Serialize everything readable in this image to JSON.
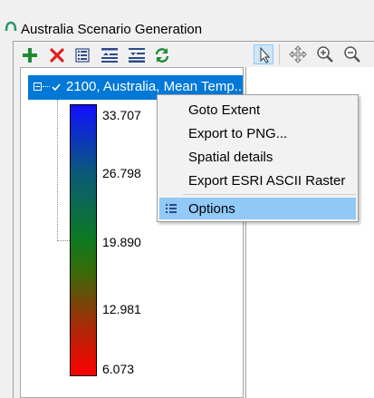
{
  "window": {
    "title": "Australia Scenario Generation",
    "app_icon": "app-icon"
  },
  "left_toolbar": {
    "buttons": [
      {
        "name": "add-layer-button",
        "icon": "plus-icon",
        "color": "#1e8a34"
      },
      {
        "name": "remove-layer-button",
        "icon": "red-x-icon",
        "color": "#e02020"
      },
      {
        "name": "properties-button",
        "icon": "list-icon",
        "color": "#2b4a8a"
      },
      {
        "name": "move-up-button",
        "icon": "move-up-icon",
        "color": "#2b4a8a"
      },
      {
        "name": "move-down-button",
        "icon": "move-down-icon",
        "color": "#2b4a8a"
      },
      {
        "name": "refresh-button",
        "icon": "refresh-icon",
        "color": "#1e8a34"
      }
    ]
  },
  "map_toolbar": {
    "buttons": [
      {
        "name": "select-tool-button",
        "icon": "pointer-icon",
        "active": true
      },
      {
        "name": "pan-tool-button",
        "icon": "pan-icon",
        "active": false
      },
      {
        "name": "zoom-in-button",
        "icon": "zoom-in-icon",
        "active": false
      },
      {
        "name": "zoom-out-button",
        "icon": "zoom-out-icon",
        "active": false
      }
    ]
  },
  "layer_tree": {
    "layer": {
      "label": "2100, Australia, Mean Temp...",
      "checked": true,
      "expanded": true
    },
    "legend": {
      "labels": [
        "33.707",
        "26.798",
        "19.890",
        "12.981",
        "6.073"
      ],
      "colors": [
        "#1010ff",
        "#0d7a20",
        "#ff0000"
      ]
    }
  },
  "context_menu": {
    "items": [
      {
        "label": "Goto Extent"
      },
      {
        "label": "Export to PNG..."
      },
      {
        "label": "Spatial details"
      },
      {
        "label": "Export ESRI ASCII Raster"
      }
    ],
    "options": {
      "label": "Options",
      "icon": "list-icon",
      "highlighted": true
    }
  },
  "colors": {
    "selection": "#0078d7",
    "menu_highlight": "#91c9f7"
  }
}
